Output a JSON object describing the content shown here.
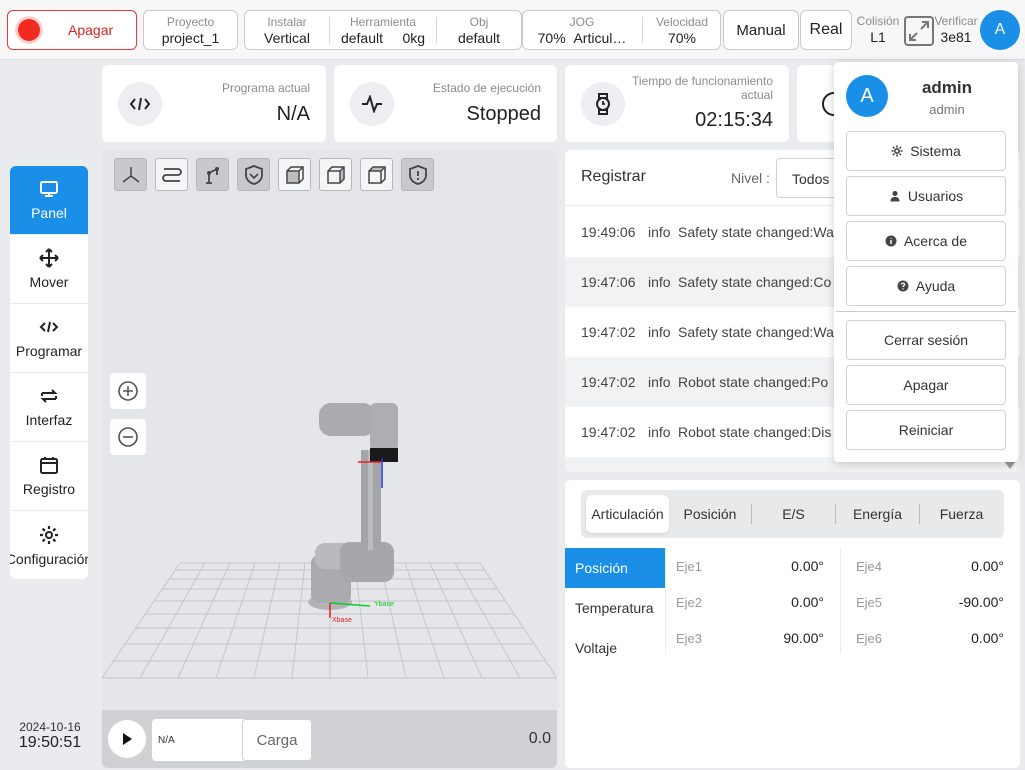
{
  "topbar": {
    "power_label": "Apagar",
    "project": {
      "caption": "Proyecto",
      "value": "project_1"
    },
    "install": {
      "caption": "Instalar",
      "value": "Vertical"
    },
    "tool": {
      "caption": "Herramienta",
      "value1": "default",
      "value2": "0kg"
    },
    "obj": {
      "caption": "Obj",
      "value": "default"
    },
    "jog": {
      "caption": "JOG",
      "value1": "70%",
      "value2": "Articul…"
    },
    "speed": {
      "caption": "Velocidad",
      "value": "70%"
    },
    "mode_label": "Manual",
    "real_label": "Real",
    "collision": {
      "caption": "Colisión",
      "value": "L1"
    },
    "verify": {
      "caption": "Verificar",
      "value": "3e81"
    },
    "avatar_letter": "A"
  },
  "nav": {
    "items": [
      {
        "label": "Panel",
        "icon": "monitor-icon"
      },
      {
        "label": "Mover",
        "icon": "move-icon"
      },
      {
        "label": "Programar",
        "icon": "code-icon"
      },
      {
        "label": "Interfaz",
        "icon": "swap-icon"
      },
      {
        "label": "Registro",
        "icon": "calendar-icon"
      },
      {
        "label": "Configuración",
        "icon": "gear-icon"
      }
    ]
  },
  "clock": {
    "date": "2024-10-16",
    "time": "19:50:51"
  },
  "cards": {
    "program": {
      "caption": "Programa actual",
      "value": "N/A"
    },
    "exec": {
      "caption": "Estado de ejecución",
      "value": "Stopped"
    },
    "uptime": {
      "caption_line1": "Tiempo de funcionamiento",
      "caption_line2": "actual",
      "value": "02:15:34"
    }
  },
  "viewport": {
    "axis_x_label": "Xbase",
    "axis_y_label": "Ybase",
    "program_field": "N/A",
    "load_label": "Carga",
    "speed_value": "0.0"
  },
  "log": {
    "title": "Registrar",
    "level_label": "Nivel :",
    "level_value": "Todos",
    "rows": [
      {
        "time": "19:49:06",
        "level": "info",
        "message": "Safety state changed:Wa"
      },
      {
        "time": "19:47:06",
        "level": "info",
        "message": "Safety state changed:Co"
      },
      {
        "time": "19:47:02",
        "level": "info",
        "message": "Safety state changed:Wa"
      },
      {
        "time": "19:47:02",
        "level": "info",
        "message": "Robot state changed:Po"
      },
      {
        "time": "19:47:02",
        "level": "info",
        "message": "Robot state changed:Dis"
      }
    ]
  },
  "joints": {
    "tabs": [
      "Articulación",
      "Posición",
      "E/S",
      "Energía",
      "Fuerza"
    ],
    "side": [
      "Posición",
      "Temperatura",
      "Voltaje"
    ],
    "values": [
      {
        "name": "Eje1",
        "value": "0.00°"
      },
      {
        "name": "Eje2",
        "value": "0.00°"
      },
      {
        "name": "Eje3",
        "value": "90.00°"
      },
      {
        "name": "Eje4",
        "value": "0.00°"
      },
      {
        "name": "Eje5",
        "value": "-90.00°"
      },
      {
        "name": "Eje6",
        "value": "0.00°"
      }
    ]
  },
  "user_menu": {
    "avatar_letter": "A",
    "name": "admin",
    "role": "admin",
    "items": [
      "Sistema",
      "Usuarios",
      "Acerca de",
      "Ayuda"
    ],
    "actions": [
      "Cerrar sesión",
      "Apagar",
      "Reiniciar"
    ]
  },
  "colors": {
    "accent": "#1a8fe8",
    "power": "#f12a22"
  }
}
